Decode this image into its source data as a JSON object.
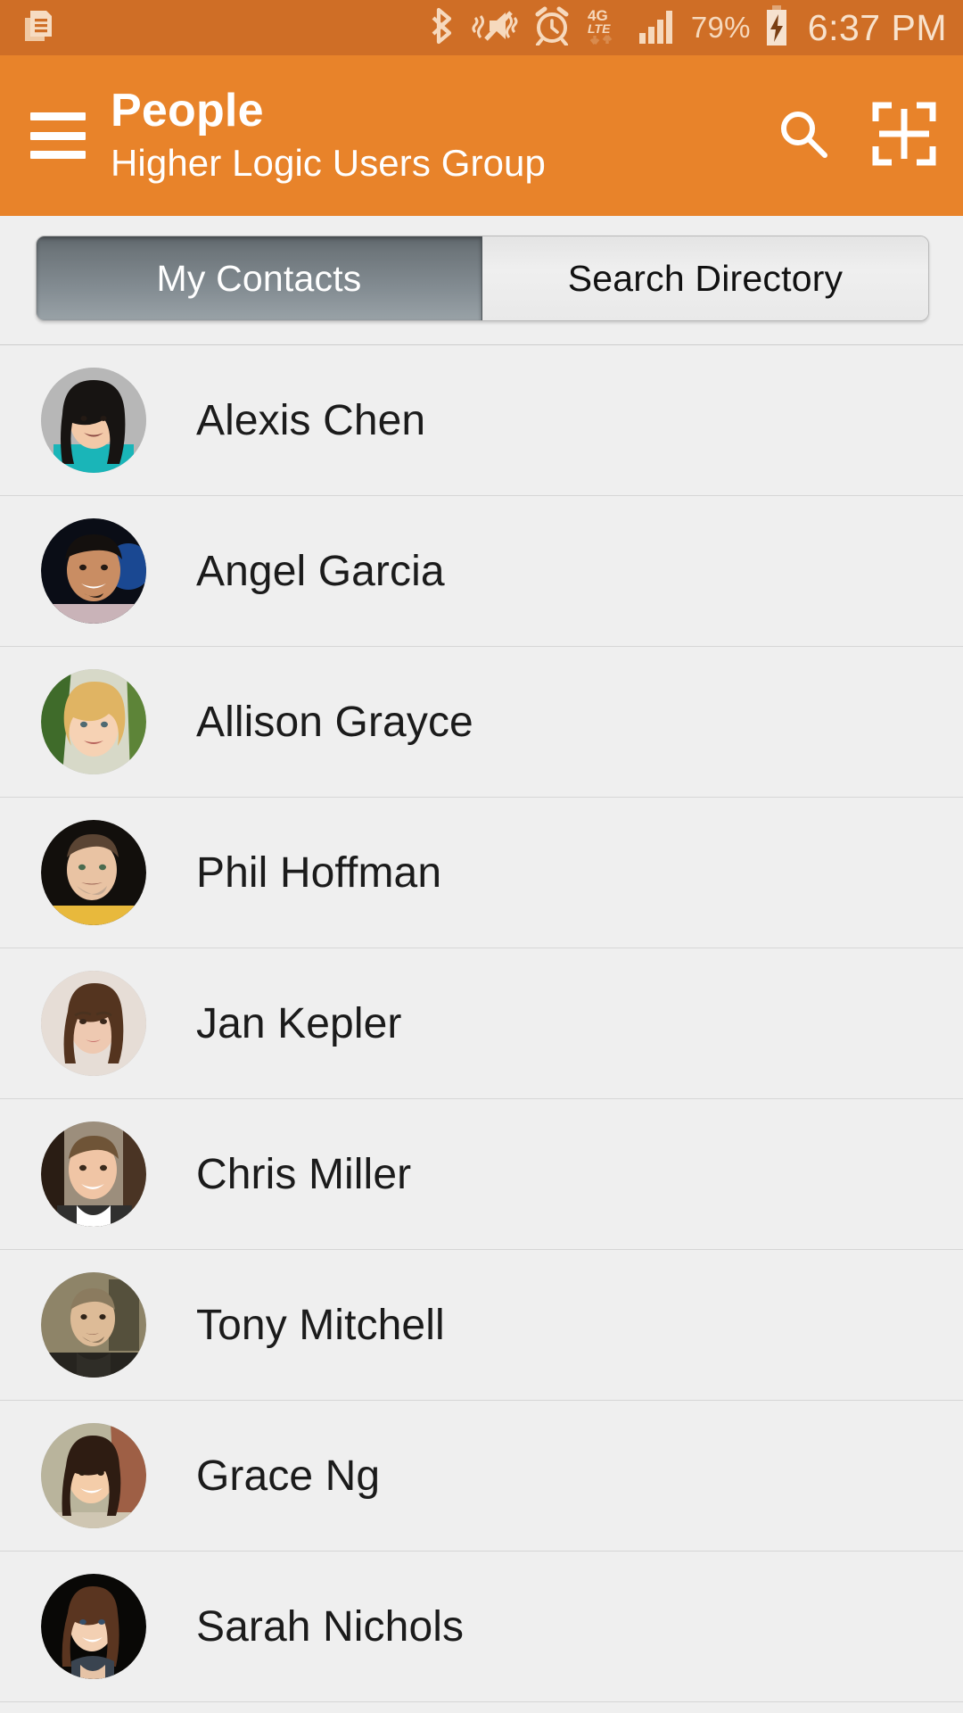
{
  "status_bar": {
    "background_color": "#cf6e26",
    "notification_icon": "document-icon",
    "icons": [
      "bluetooth-icon",
      "vibrate-mute-icon",
      "alarm-icon",
      "network-4g-lte-icon",
      "signal-bars-icon"
    ],
    "network_label_top": "4G",
    "network_label_bottom": "LTE",
    "battery_percent": "79%",
    "battery_state": "charging",
    "time": "6:37 PM"
  },
  "app_bar": {
    "background_color": "#e8832a",
    "menu_icon": "hamburger-menu-icon",
    "title": "People",
    "subtitle": "Higher Logic Users Group",
    "actions": [
      {
        "name": "search-icon",
        "label": "Search"
      },
      {
        "name": "scan-grid-icon",
        "label": "Scan"
      }
    ]
  },
  "tabs": {
    "active_index": 0,
    "items": [
      {
        "label": "My Contacts",
        "active": true
      },
      {
        "label": "Search Directory",
        "active": false
      }
    ]
  },
  "contacts": {
    "list_background": "#efefef",
    "items": [
      {
        "name": "Alexis Chen",
        "avatar": "photo-alexis-chen"
      },
      {
        "name": "Angel Garcia",
        "avatar": "photo-angel-garcia"
      },
      {
        "name": "Allison Grayce",
        "avatar": "photo-allison-grayce"
      },
      {
        "name": "Phil Hoffman",
        "avatar": "photo-phil-hoffman"
      },
      {
        "name": "Jan Kepler",
        "avatar": "photo-jan-kepler"
      },
      {
        "name": "Chris Miller",
        "avatar": "photo-chris-miller"
      },
      {
        "name": "Tony Mitchell",
        "avatar": "photo-tony-mitchell"
      },
      {
        "name": "Grace Ng",
        "avatar": "photo-grace-ng"
      },
      {
        "name": "Sarah Nichols",
        "avatar": "photo-sarah-nichols"
      }
    ]
  }
}
